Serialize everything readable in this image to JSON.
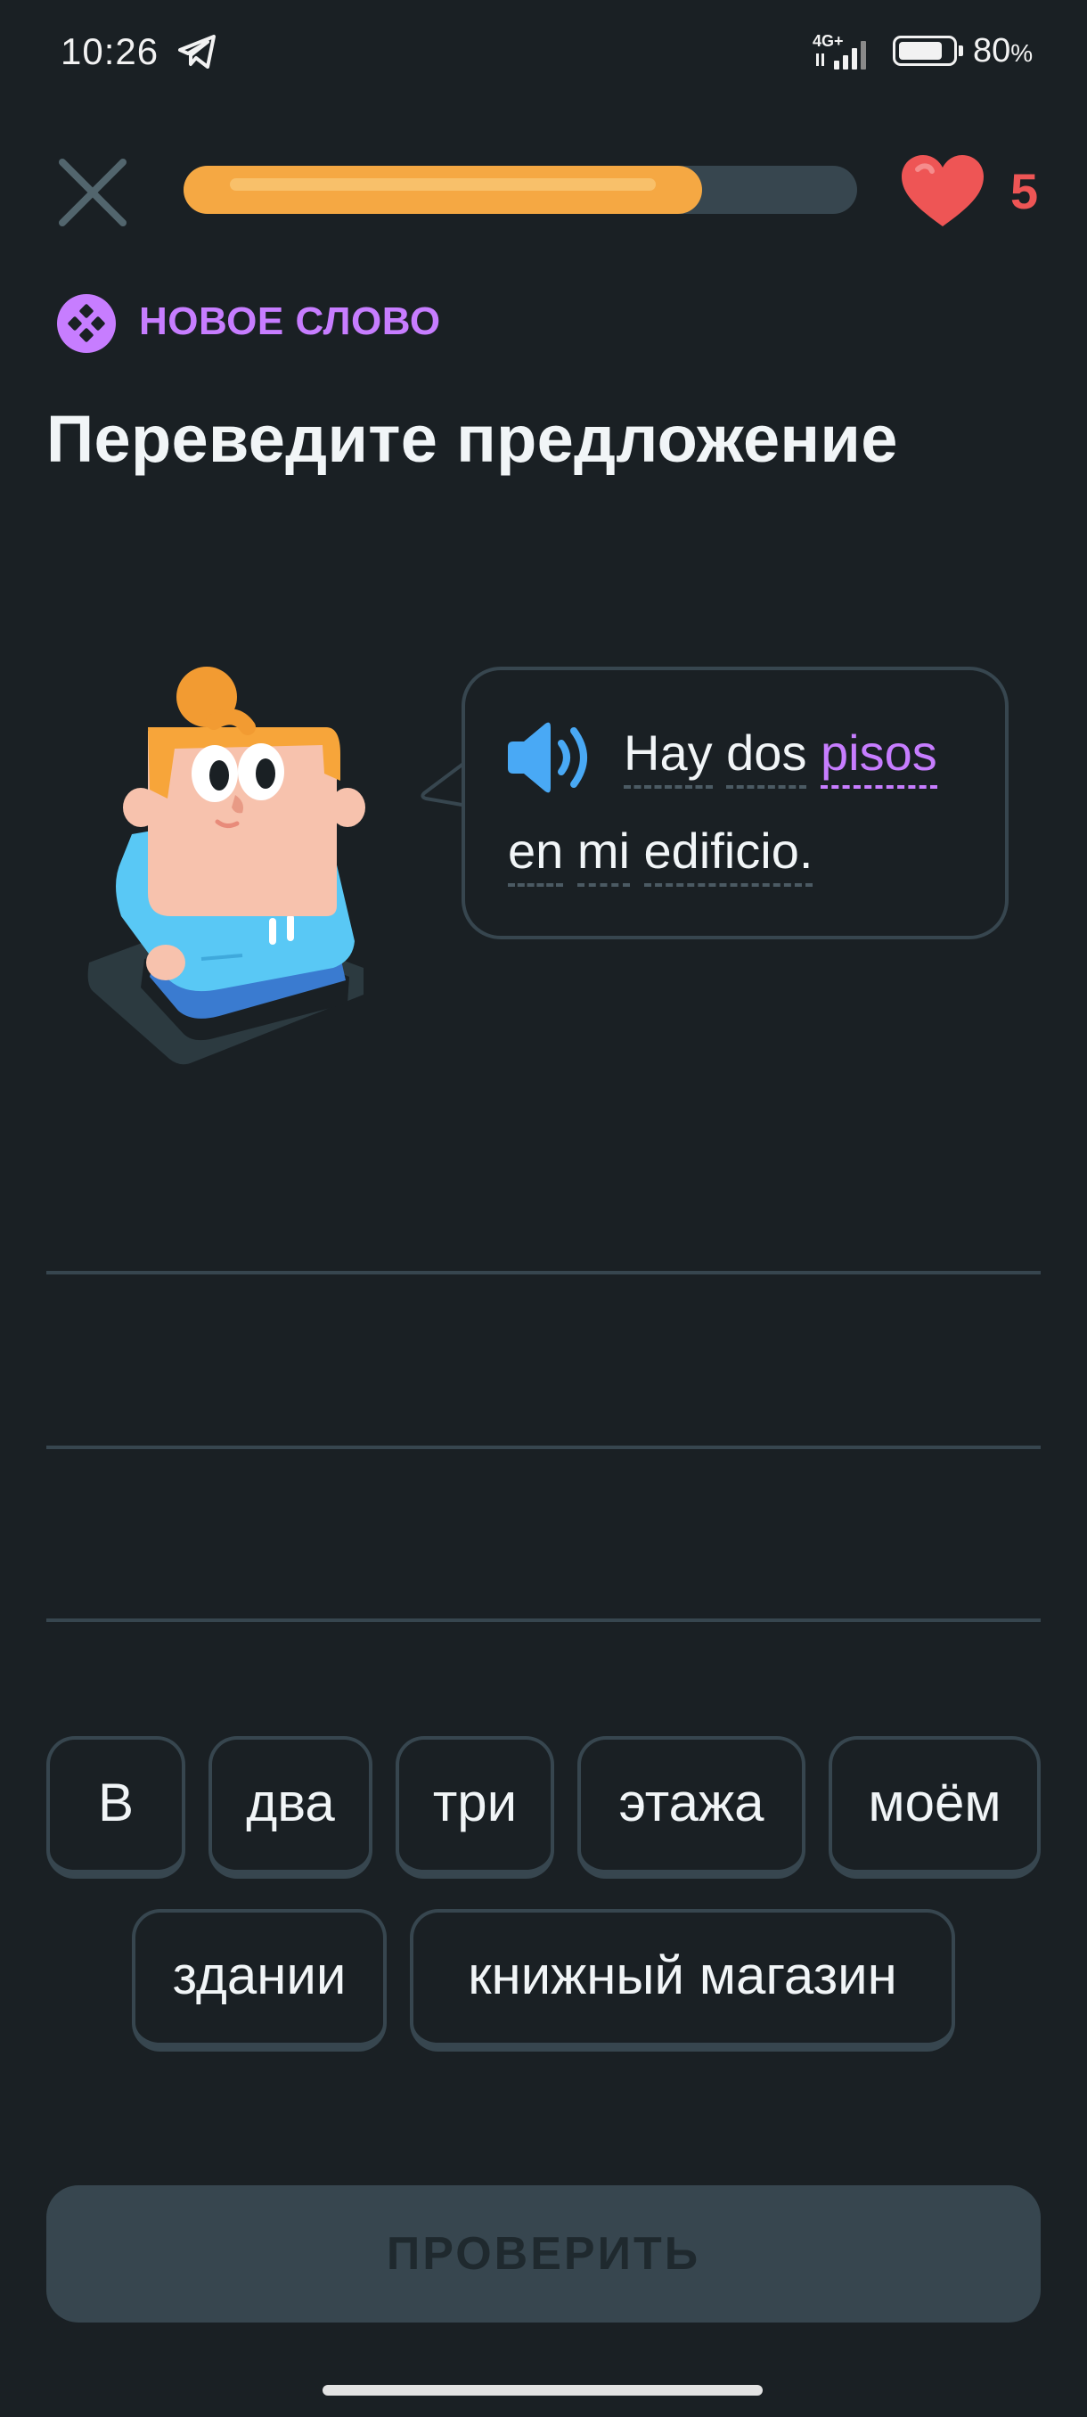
{
  "status_bar": {
    "time": "10:26",
    "network": "4G+",
    "battery_value": "80",
    "battery_unit": "%"
  },
  "lesson": {
    "progress_fraction": 0.77,
    "hearts": "5",
    "badge_label": "НОВОЕ СЛОВО",
    "title": "Переведите предложение"
  },
  "sentence": {
    "line1": [
      {
        "text": "Hay",
        "new": false
      },
      {
        "text": "dos",
        "new": false
      },
      {
        "text": "pisos",
        "new": true
      }
    ],
    "line2": [
      {
        "text": "en",
        "new": false
      },
      {
        "text": "mi",
        "new": false
      },
      {
        "text": "edificio.",
        "new": false
      }
    ]
  },
  "word_bank": {
    "row1": [
      "В",
      "два",
      "три",
      "этажа",
      "моём"
    ],
    "row2": [
      "здании",
      "книжный магазин"
    ]
  },
  "check_button": {
    "label": "ПРОВЕРИТЬ"
  },
  "colors": {
    "background": "#1a2024",
    "accent_progress": "#f5a843",
    "new_word": "#c77dff",
    "heart": "#ee5555",
    "speaker": "#49a9f5",
    "border": "#37464f"
  },
  "icons": {
    "close": "close-icon",
    "heart": "heart-icon",
    "speaker": "speaker-icon",
    "badge": "new-word-icon"
  }
}
